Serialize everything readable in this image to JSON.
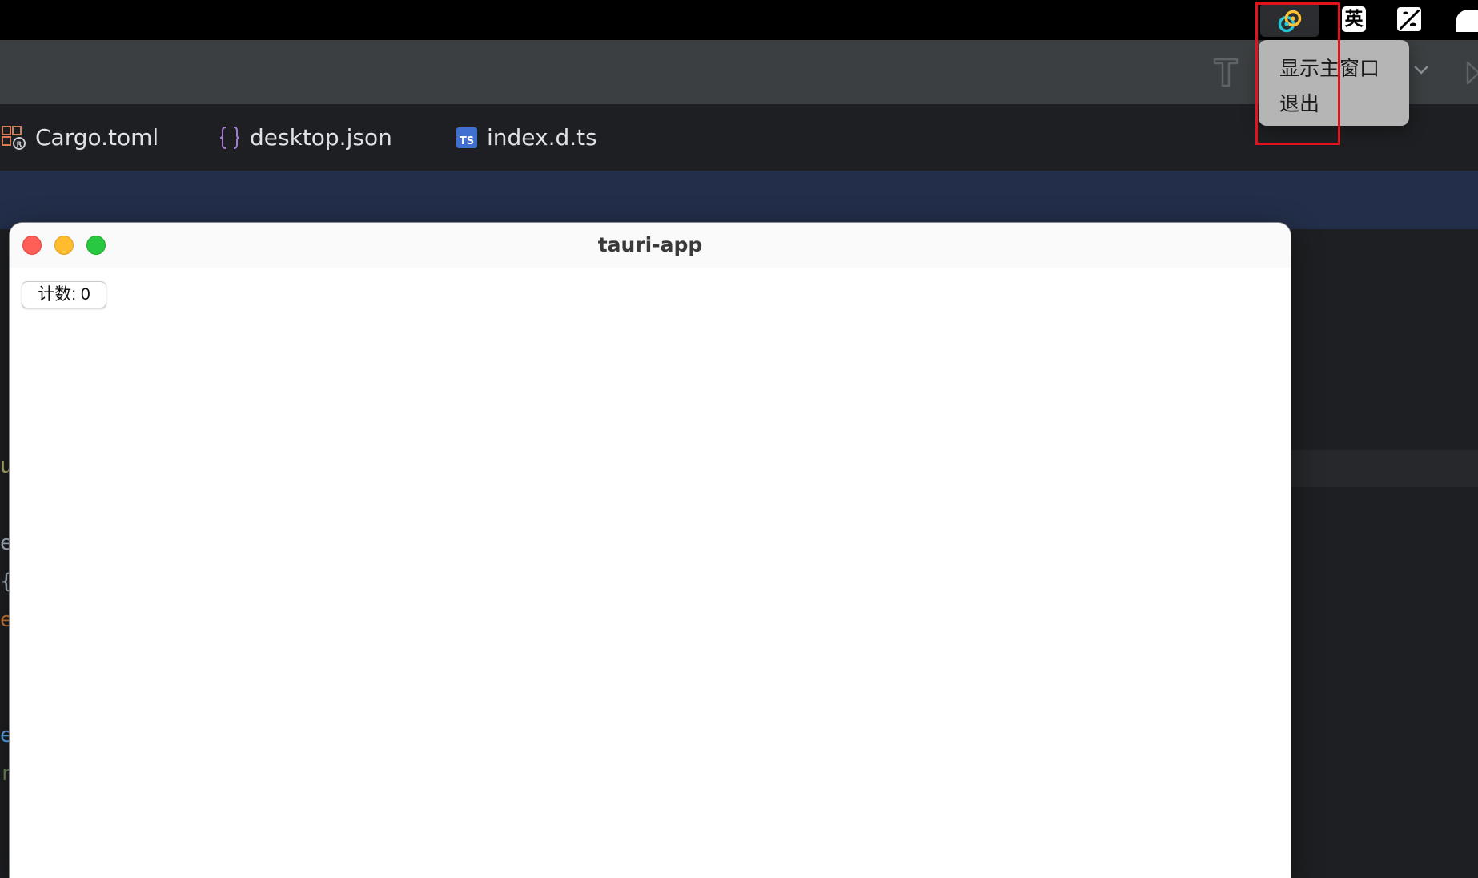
{
  "menubar": {
    "ime_label": "英"
  },
  "tray_menu": {
    "items": [
      {
        "label": "显示主窗口"
      },
      {
        "label": "退出"
      }
    ]
  },
  "ide": {
    "tabs": [
      {
        "label": "Cargo.toml",
        "icon": "cargo-file-icon"
      },
      {
        "label": "desktop.json",
        "icon": "json-braces-icon"
      },
      {
        "label": "index.d.ts",
        "icon": "typescript-file-icon",
        "badge": "TS"
      }
    ],
    "code_fragments": [
      {
        "text": "u",
        "color": "#b3ae60"
      },
      {
        "text": "e",
        "color": "#a9b7c6"
      },
      {
        "text": "{",
        "color": "#a9b7c6"
      },
      {
        "text": "e",
        "color": "#cc7832"
      },
      {
        "text": "e",
        "color": "#56a8f5"
      },
      {
        "text": "r",
        "color": "#6a8759"
      }
    ]
  },
  "app_window": {
    "title": "tauri-app",
    "counter_button": "计数: 0"
  },
  "colors": {
    "highlight": "#e3131e",
    "close": "#ff5f57",
    "minimize": "#febc2e",
    "maximize": "#28c840"
  }
}
